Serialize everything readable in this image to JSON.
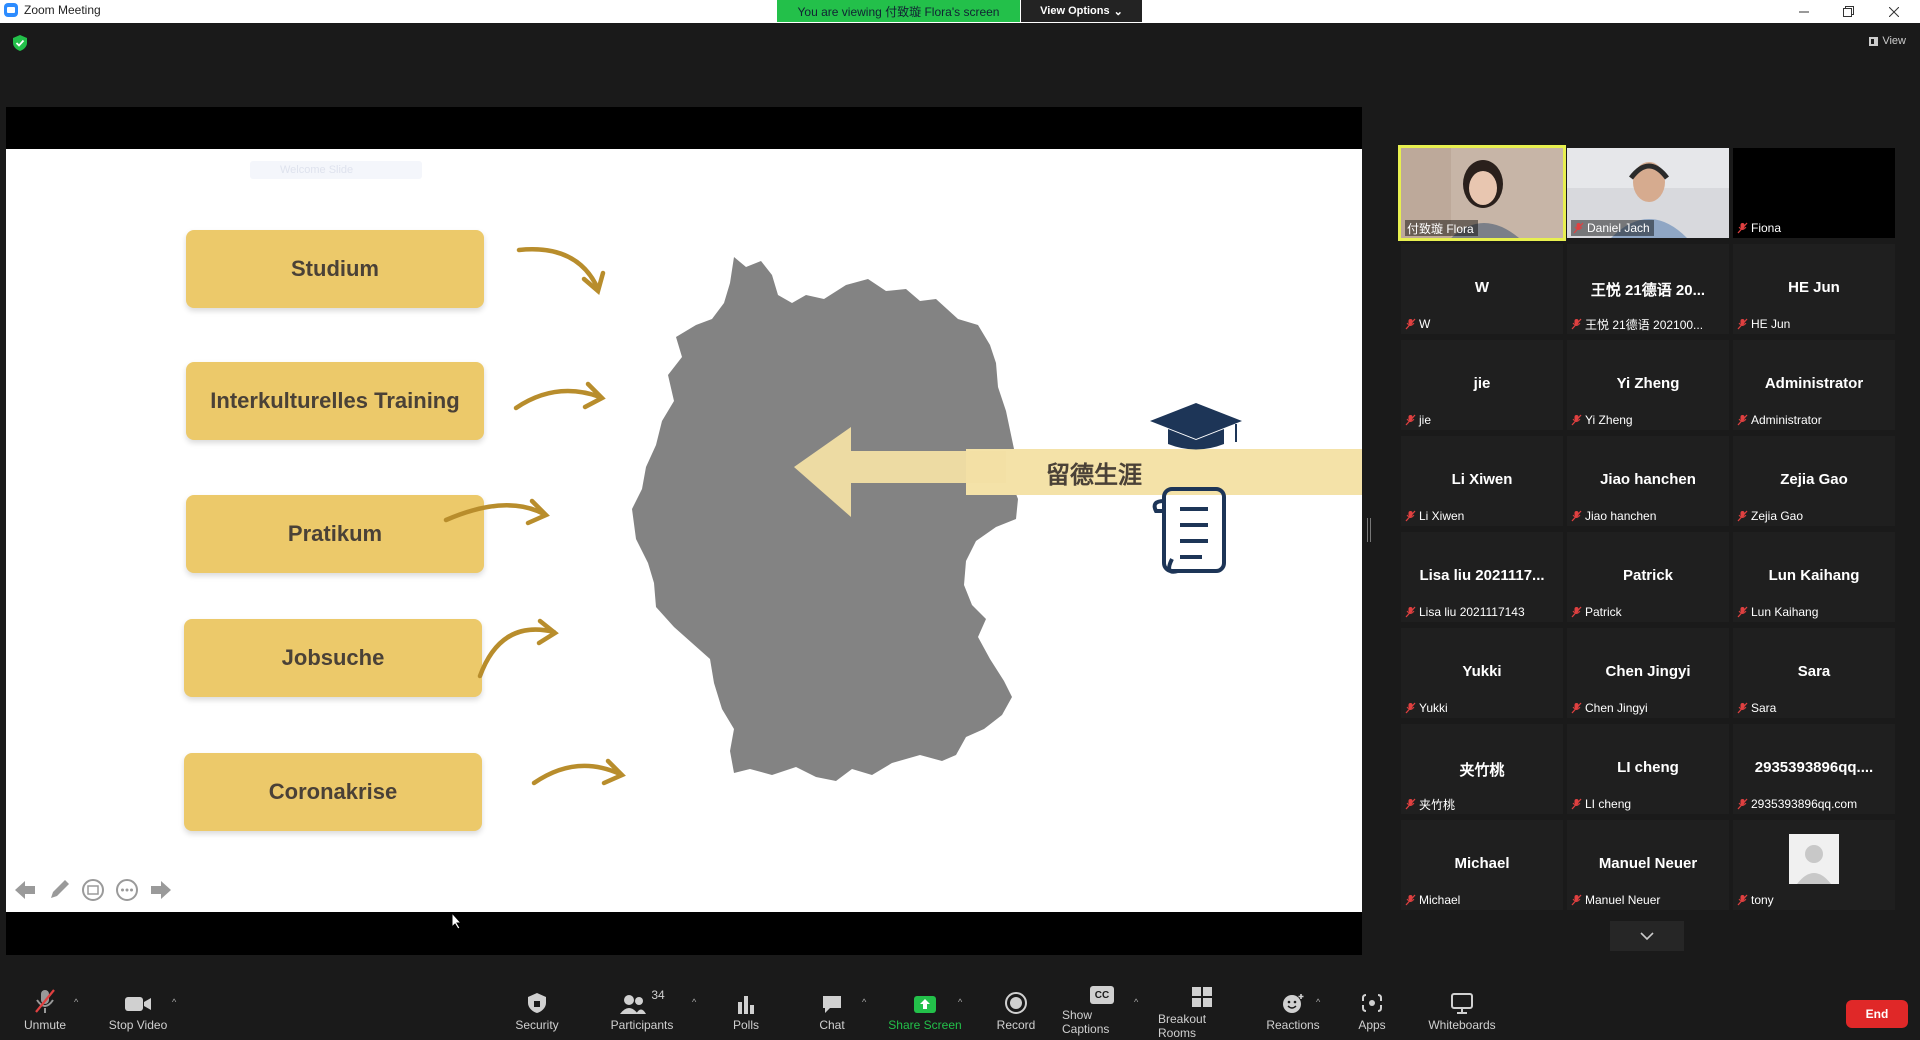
{
  "window": {
    "title": "Zoom Meeting",
    "banner": "You are viewing 付致璇 Flora's screen",
    "view_options": "View Options",
    "view_button": "View"
  },
  "slide": {
    "watermark": "Welcome Slide",
    "boxes": [
      "Studium",
      "Interkulturelles Training",
      "Pratikum",
      "Jobsuche",
      "Coronakrise"
    ],
    "arrow_label": "留德生涯"
  },
  "video_tiles": [
    {
      "name": "付致璇 Flora",
      "active": true
    },
    {
      "name": "Daniel Jach",
      "active": false
    },
    {
      "name": "Fiona",
      "active": false
    }
  ],
  "participants": [
    {
      "big": "W",
      "label": "W"
    },
    {
      "big": "王悦 21德语 20...",
      "label": "王悦 21德语 202100..."
    },
    {
      "big": "HE Jun",
      "label": "HE Jun"
    },
    {
      "big": "jie",
      "label": "jie"
    },
    {
      "big": "Yi Zheng",
      "label": "Yi Zheng"
    },
    {
      "big": "Administrator",
      "label": "Administrator"
    },
    {
      "big": "Li Xiwen",
      "label": "Li Xiwen"
    },
    {
      "big": "Jiao hanchen",
      "label": "Jiao hanchen"
    },
    {
      "big": "Zejia Gao",
      "label": "Zejia Gao"
    },
    {
      "big": "Lisa liu 2021117...",
      "label": "Lisa liu 2021117143"
    },
    {
      "big": "Patrick",
      "label": "Patrick"
    },
    {
      "big": "Lun Kaihang",
      "label": "Lun Kaihang"
    },
    {
      "big": "Yukki",
      "label": "Yukki"
    },
    {
      "big": "Chen Jingyi",
      "label": "Chen Jingyi"
    },
    {
      "big": "Sara",
      "label": "Sara"
    },
    {
      "big": "夹竹桃",
      "label": "夹竹桃"
    },
    {
      "big": "LI cheng",
      "label": "LI cheng"
    },
    {
      "big": "2935393896qq....",
      "label": "2935393896qq.com"
    },
    {
      "big": "Michael",
      "label": "Michael"
    },
    {
      "big": "Manuel Neuer",
      "label": "Manuel Neuer"
    },
    {
      "big": "",
      "label": "tony"
    }
  ],
  "toolbar": {
    "unmute": "Unmute",
    "stop_video": "Stop Video",
    "security": "Security",
    "participants": "Participants",
    "participants_count": "34",
    "polls": "Polls",
    "chat": "Chat",
    "share_screen": "Share Screen",
    "record": "Record",
    "show_captions": "Show Captions",
    "captions_badge": "CC",
    "breakout_rooms": "Breakout Rooms",
    "reactions": "Reactions",
    "apps": "Apps",
    "whiteboards": "Whiteboards",
    "end": "End"
  },
  "colors": {
    "banner_green": "#23c04a",
    "slide_box": "#ecc96a",
    "arrow_gold": "#b88d2c",
    "map_gray": "#838383",
    "navy": "#1d3557",
    "end_red": "#e02828",
    "active_outline": "#e8f04f"
  }
}
